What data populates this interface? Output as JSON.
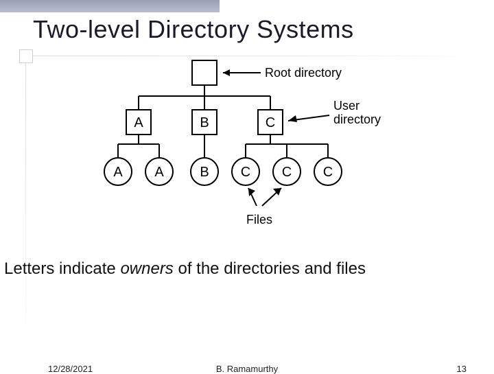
{
  "slide": {
    "title": "Two-level Directory Systems",
    "caption_pre": "Letters indicate ",
    "caption_em": "owners",
    "caption_post": " of the directories and files"
  },
  "footer": {
    "date": "12/28/2021",
    "author": "B. Ramamurthy",
    "page": "13"
  },
  "diagram": {
    "root_label": "Root directory",
    "user_dir_label": "User\ndirectory",
    "files_label": "Files",
    "level1": [
      "A",
      "B",
      "C"
    ],
    "level2": [
      "A",
      "A",
      "B",
      "C",
      "C",
      "C"
    ]
  }
}
